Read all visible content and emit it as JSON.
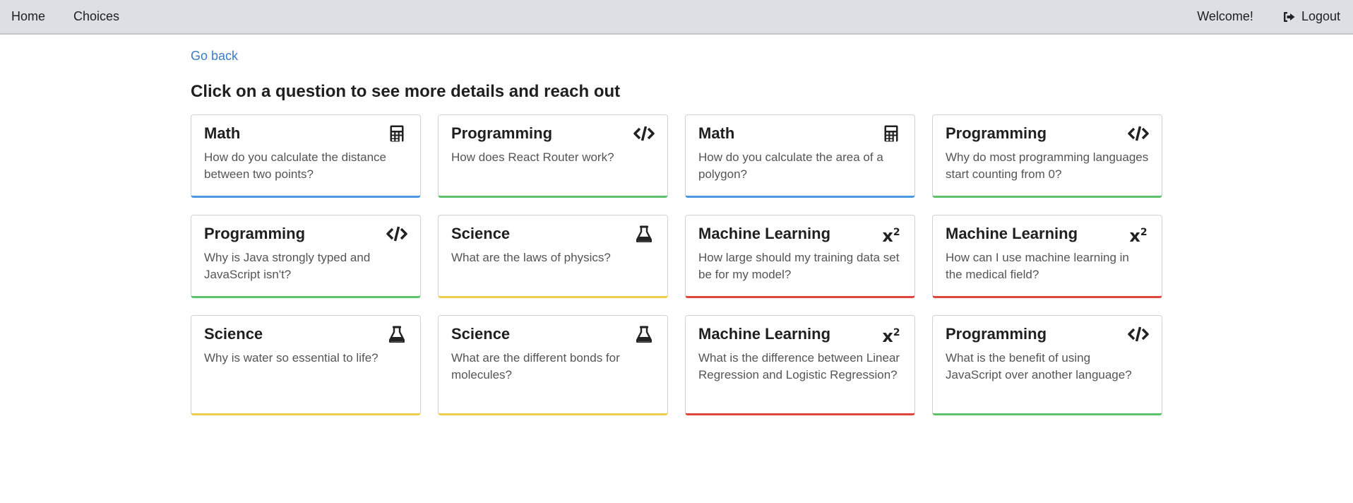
{
  "nav": {
    "home": "Home",
    "choices": "Choices",
    "welcome": "Welcome!",
    "logout": "Logout"
  },
  "page": {
    "go_back": "Go back",
    "heading": "Click on a question to see more details and reach out"
  },
  "colors": {
    "Math": "#4c98e0",
    "Programming": "#5cc26b",
    "Science": "#f0cb49",
    "Machine Learning": "#e0443b"
  },
  "cards": [
    {
      "category": "Math",
      "icon": "calculator-icon",
      "question": "How do you calculate the distance between two points?"
    },
    {
      "category": "Programming",
      "icon": "code-icon",
      "question": "How does React Router work?"
    },
    {
      "category": "Math",
      "icon": "calculator-icon",
      "question": "How do you calculate the area of a polygon?"
    },
    {
      "category": "Programming",
      "icon": "code-icon",
      "question": "Why do most programming languages start counting from 0?"
    },
    {
      "category": "Programming",
      "icon": "code-icon",
      "question": "Why is Java strongly typed and JavaScript isn't?"
    },
    {
      "category": "Science",
      "icon": "flask-icon",
      "question": "What are the laws of physics?"
    },
    {
      "category": "Machine Learning",
      "icon": "superscript-icon",
      "question": "How large should my training data set be for my model?"
    },
    {
      "category": "Machine Learning",
      "icon": "superscript-icon",
      "question": "How can I use machine learning in the medical field?"
    },
    {
      "category": "Science",
      "icon": "flask-icon",
      "question": "Why is water so essential to life?"
    },
    {
      "category": "Science",
      "icon": "flask-icon",
      "question": "What are the different bonds for molecules?"
    },
    {
      "category": "Machine Learning",
      "icon": "superscript-icon",
      "question": "What is the difference between Linear Regression and Logistic Regression?"
    },
    {
      "category": "Programming",
      "icon": "code-icon",
      "question": "What is the benefit of using JavaScript over another language?"
    }
  ]
}
